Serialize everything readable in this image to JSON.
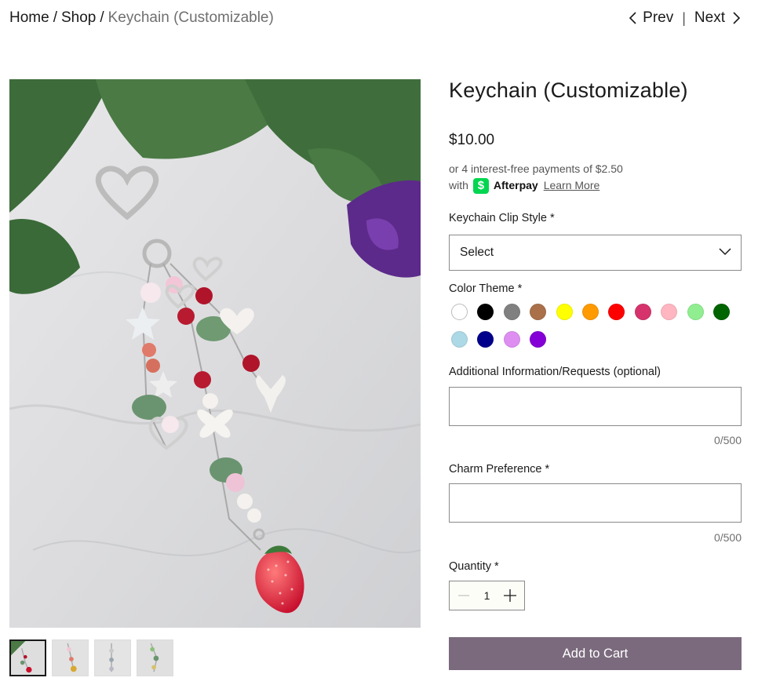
{
  "breadcrumb": {
    "home": "Home",
    "shop": "Shop",
    "separator": "/",
    "current": "Keychain (Customizable)"
  },
  "pager": {
    "prev": "Prev",
    "next": "Next",
    "divider": "|"
  },
  "product": {
    "title": "Keychain (Customizable)",
    "price": "$10.00",
    "afterpay_line1": "or 4 interest-free payments of $2.50",
    "afterpay_with": "with",
    "afterpay_logo_glyph": "$",
    "afterpay_name": "Afterpay",
    "afterpay_link": "Learn More"
  },
  "options": {
    "clip_style_label": "Keychain Clip Style *",
    "clip_style_value": "Select",
    "color_theme_label": "Color Theme *",
    "colors": [
      {
        "name": "white",
        "hex": "#ffffff"
      },
      {
        "name": "black",
        "hex": "#000000"
      },
      {
        "name": "gray",
        "hex": "#808080"
      },
      {
        "name": "brown",
        "hex": "#a9704a"
      },
      {
        "name": "yellow",
        "hex": "#ffff00"
      },
      {
        "name": "orange",
        "hex": "#ff9a00"
      },
      {
        "name": "red",
        "hex": "#ff0000"
      },
      {
        "name": "raspberry",
        "hex": "#d6336c"
      },
      {
        "name": "pink",
        "hex": "#ffb6c1"
      },
      {
        "name": "light-green",
        "hex": "#90ee90"
      },
      {
        "name": "dark-green",
        "hex": "#006400"
      },
      {
        "name": "light-blue",
        "hex": "#add8e6"
      },
      {
        "name": "navy",
        "hex": "#00008b"
      },
      {
        "name": "violet",
        "hex": "#dd8ef0"
      },
      {
        "name": "purple",
        "hex": "#8400d6"
      }
    ],
    "additional_label": "Additional Information/Requests (optional)",
    "additional_counter": "0/500",
    "charm_label": "Charm Preference *",
    "charm_counter": "0/500",
    "quantity_label": "Quantity *",
    "quantity_value": "1",
    "add_to_cart": "Add to Cart"
  },
  "colors": {
    "button_bg": "#7b6a7d",
    "afterpay_green": "#00d64f"
  }
}
